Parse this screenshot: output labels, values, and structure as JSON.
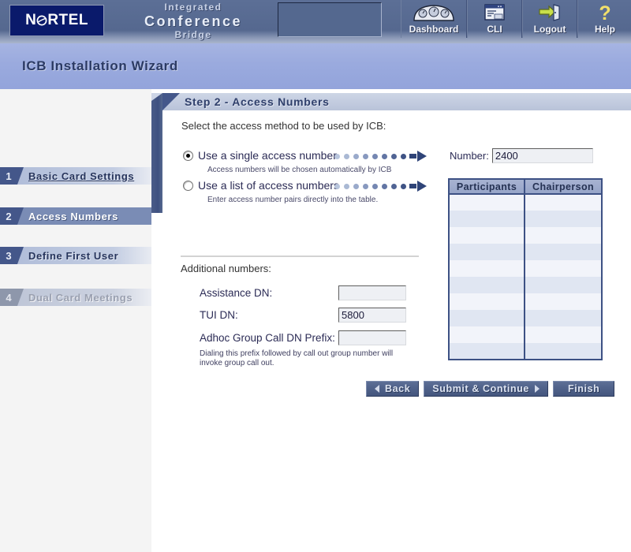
{
  "header": {
    "logo_text_pre": "N",
    "logo_text_post": "RTEL",
    "logo_icon": "nortel-globe-icon",
    "brand_line1": "Integrated",
    "brand_line2": "Conference",
    "brand_line3": "Bridge",
    "toolbar": [
      {
        "label": "Dashboard",
        "icon": "gauge-dashboard-icon",
        "name": "toolbar-dashboard"
      },
      {
        "label": "CLI",
        "icon": "terminal-window-icon",
        "name": "toolbar-cli"
      },
      {
        "label": "Logout",
        "icon": "exit-door-arrow-icon",
        "name": "toolbar-logout"
      },
      {
        "label": "Help",
        "icon": "question-mark-icon",
        "name": "toolbar-help"
      }
    ]
  },
  "wizard": {
    "title": "ICB Installation Wizard"
  },
  "sidebar": {
    "steps": [
      {
        "num": "1",
        "label": "Basic  Card Settings",
        "state": "link"
      },
      {
        "num": "2",
        "label": "Access Numbers",
        "state": "active"
      },
      {
        "num": "3",
        "label": "Define First User",
        "state": "link"
      },
      {
        "num": "4",
        "label": "Dual Card Meetings",
        "state": "disabled"
      }
    ]
  },
  "main": {
    "step_header": "Step 2 - Access Numbers",
    "intro": "Select the access method to be used by ICB:",
    "options": [
      {
        "title": "Use a single access number",
        "sub": "Access numbers will be chosen automatically by ICB",
        "selected": true
      },
      {
        "title": "Use a list of access numbers",
        "sub": "Enter access number pairs directly into the table.",
        "selected": false
      }
    ],
    "number_field": {
      "label": "Number:",
      "value": "2400",
      "placeholder": ""
    },
    "table": {
      "columns": [
        "Participants",
        "Chairperson"
      ],
      "rows": [
        [
          "",
          ""
        ],
        [
          "",
          ""
        ],
        [
          "",
          ""
        ],
        [
          "",
          ""
        ],
        [
          "",
          ""
        ],
        [
          "",
          ""
        ],
        [
          "",
          ""
        ],
        [
          "",
          ""
        ],
        [
          "",
          ""
        ],
        [
          "",
          ""
        ]
      ]
    },
    "additional": {
      "title": "Additional numbers:",
      "fields": [
        {
          "label": "Assistance DN:",
          "value": "",
          "placeholder": ""
        },
        {
          "label": "TUI DN:",
          "value": "5800",
          "placeholder": ""
        },
        {
          "label": "Adhoc Group Call DN Prefix:",
          "value": "",
          "placeholder": ""
        }
      ],
      "hint": "Dialing this prefix followed by call out group number will invoke group call out."
    },
    "buttons": {
      "back": "Back",
      "submit": "Submit & Continue",
      "finish": "Finish"
    }
  },
  "colors": {
    "brand_navy": "#0a1a6b",
    "header_blue": "#55688f",
    "band_periwinkle": "#9aaade",
    "accent_dark": "#3d5184",
    "active_step": "#7a8cb5"
  }
}
